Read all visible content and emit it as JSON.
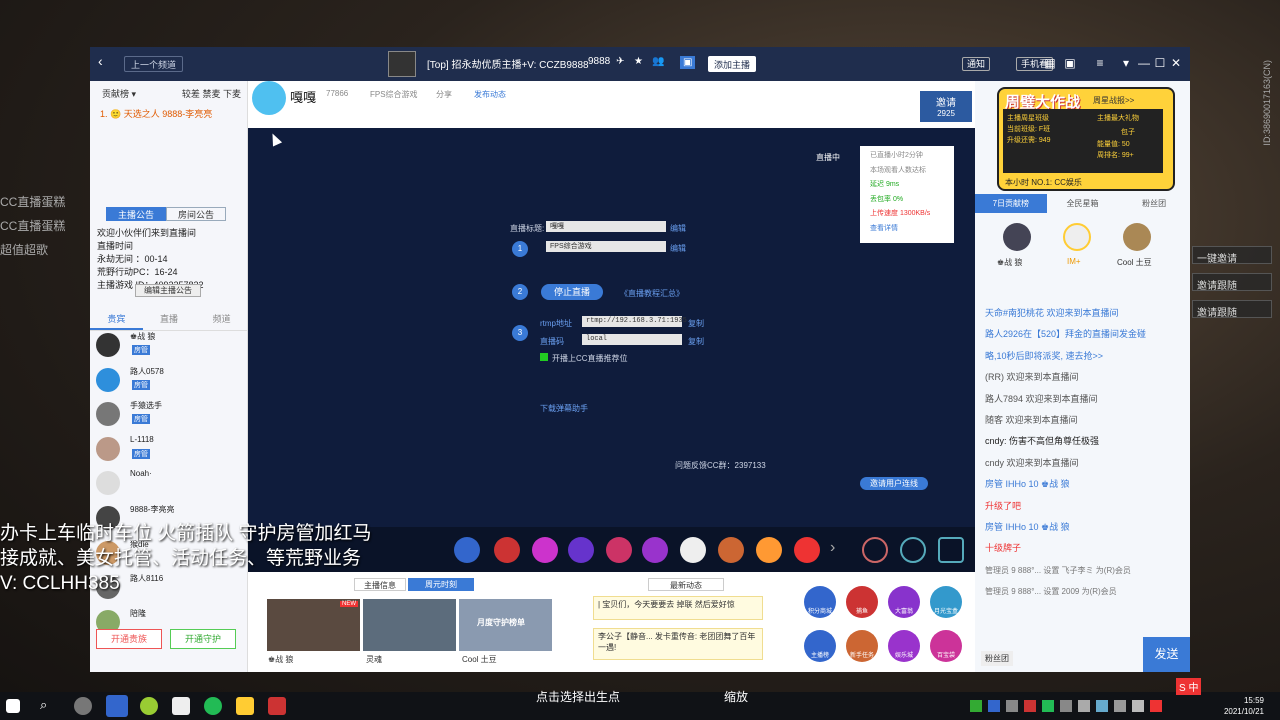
{
  "window": {
    "title": "[Top] 招永劫优质主播+V: CCZB9888",
    "room_id": "9888",
    "prev_label": "上一个频道",
    "add_anchor_label": "添加主播",
    "notify_label": "通知",
    "mobile_label": "手机看"
  },
  "left_panel": {
    "rank_title": "贡献榜 ▾",
    "rank_tabs": [
      "较差",
      "禁麦",
      "下麦"
    ],
    "rank_first": "1. 🙂 天选之人 9888-李亮亮",
    "tabs": [
      "主播公告",
      "房间公告"
    ],
    "notice_lines": [
      "欢迎小伙伴们来到直播间",
      "直播时间",
      "永劫无间 ：00-14",
      "荒野行动PC：16-24",
      "主播游戏 ID：4092257822"
    ],
    "edit_notice_label": "编辑主播公告",
    "list_tabs": [
      "贵宾",
      "直播",
      "频道"
    ],
    "users": [
      {
        "name": "♚战 狼",
        "badge": "房管"
      },
      {
        "name": "路人0578",
        "badge": "房管"
      },
      {
        "name": "手猿选手",
        "badge": "房管"
      },
      {
        "name": "L-1118",
        "badge": "房管"
      },
      {
        "name": "Noah·",
        "badge": ""
      },
      {
        "name": "9888-李亮亮",
        "badge": ""
      },
      {
        "name": "猴die",
        "badge": ""
      },
      {
        "name": "路人8116",
        "badge": ""
      },
      {
        "name": "陪隆",
        "badge": ""
      }
    ],
    "vip_buttons": [
      "开通贵族",
      "开通守护"
    ]
  },
  "center": {
    "anchor_name": "嘎嘎",
    "heat": "77866",
    "category": "FPS综合游戏",
    "share": "分享",
    "subscribe": "发布动态",
    "invite_label": "邀请",
    "invite_count": "2925",
    "live_indicator": "直播中",
    "stats": [
      "已直播小时2分钟",
      "本场观看人数达标",
      "延迟   9ms",
      "丢包率   0%",
      "上传速度  1300KB/s",
      "查看详情"
    ],
    "form": {
      "title_label": "直播标题:",
      "title_value": "嘎嘎",
      "category_value": "FPS综合游戏",
      "edit_label": "编辑",
      "stop_label": "停止直播",
      "tutorial_label": "《直播教程汇总》",
      "rtmp_label": "rtmp地址",
      "rtmp_value": "rtmp://192.168.3.71:1935",
      "key_label": "直播码",
      "key_value": "local",
      "copy_label": "复制",
      "recommend_label": "开播上CC直播推荐位",
      "download_label": "下载弹幕助手"
    },
    "feedback": "问题反馈CC群：2397133",
    "mic_label": "邀请用户连线",
    "bottom_tabs": [
      "主播信息",
      "周元时刻"
    ],
    "news_label": "最新动态",
    "thumbs": [
      "♚战 狼",
      "灵魂",
      "Cool 土豆"
    ],
    "thumb_new": "NEW",
    "thumb_caption": "月度守护榜单",
    "dyn_items": [
      "| 宝贝们，今天要要去 掉联 然后爱好惊",
      "李公子【静音... 发卡重传音: 老团团舞了百年一遇!"
    ],
    "app_icons": [
      "积分商城",
      "捕鱼",
      "大富翁",
      "月光宝盒",
      "主播榜",
      "新手任务",
      "娱乐城",
      "百宝袋"
    ]
  },
  "right_panel": {
    "promo_title": "周璧大作战",
    "promo_sub": "周星战报>>",
    "promo_lines": [
      "主播周星班级",
      "当前班级: F班",
      "升级还需: 949",
      "主播最大礼物",
      "包子",
      "能量值: 50",
      "周排名: 99+",
      "本小时 NO.1: CC娱乐"
    ],
    "tabs": [
      "7日贡献榜",
      "全民星箱",
      "粉丝团"
    ],
    "top3": [
      "♚战 狼",
      "IM+",
      "Cool 土豆"
    ],
    "chat": [
      "天命#南犯桃花  欢迎来到本直播间",
      "路人2926在【520】拜金的直播间发金碰",
      "略,10秒后即将派奖, 速去抢>>",
      "(RR)  欢迎来到本直播间",
      "路人7894  欢迎来到本直播间",
      "随客  欢迎来到本直播间",
      "cndy:  伤害不高但角尊任极强",
      "cndy  欢迎来到本直播间",
      "房管 IHHo 10 ♚战 狼",
      "升级了吧",
      "房管 IHHo 10 ♚战 狼",
      "十级牌子",
      "管理员  9 888°... 设置  飞子李ミ  为(R)会员",
      "管理员  9 888°... 设置  2009  为(R)会员"
    ],
    "send_label": "发送",
    "fans_label": "粉丝团"
  },
  "desktop": {
    "left_items": [
      "CC直播蛋糕",
      "CC直播蛋糕",
      "超值超歌"
    ],
    "right_items": [
      "一键邀请",
      "邀请跟随",
      "邀请跟随"
    ],
    "vertical_id": "ID:38690017163(CN)",
    "overlay_lines": [
      "办卡上车临时车位 火箭插队 守护房管加红马",
      "接成就、美女托管、活动任务、等荒野业务",
      "V: CCLHH385"
    ],
    "taskbar_center": [
      "点击选择出生点",
      "缩放"
    ],
    "clock_time": "15:59",
    "clock_date": "2021/10/21",
    "ime": "中"
  }
}
